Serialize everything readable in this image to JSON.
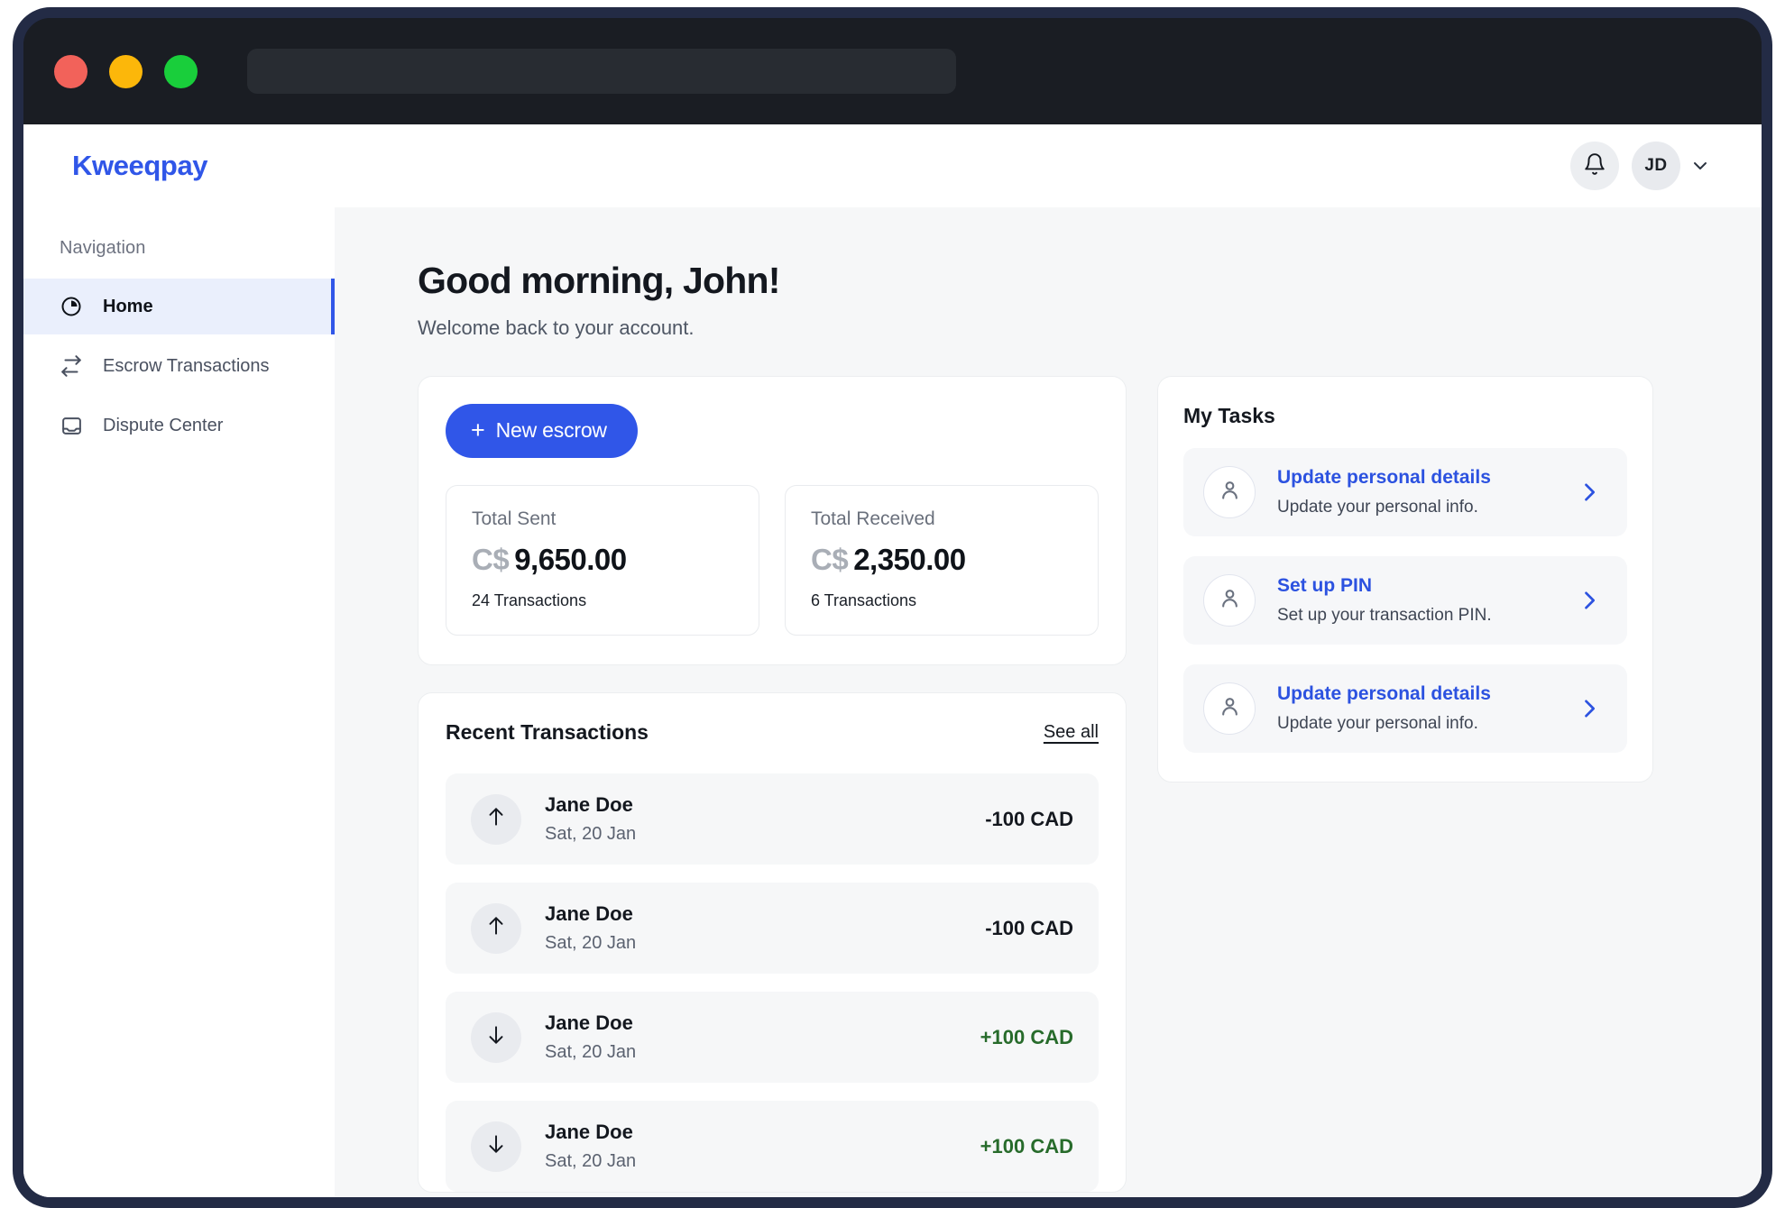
{
  "window": {
    "traffic_lights": [
      {
        "name": "close",
        "color": "#f2625a"
      },
      {
        "name": "minimize",
        "color": "#fcb70a"
      },
      {
        "name": "maximize",
        "color": "#19ce3b"
      }
    ],
    "url_value": "",
    "url_placeholder": ""
  },
  "app_bar": {
    "brand": "Kweeqpay",
    "notification_icon": "bell-icon",
    "avatar_initials": "JD",
    "chevron_icon": "chevron-down-icon"
  },
  "sidebar": {
    "heading": "Navigation",
    "items": [
      {
        "label": "Home",
        "icon": "clock-pie-icon",
        "active": true
      },
      {
        "label": "Escrow Transactions",
        "icon": "exchange-arrows-icon",
        "active": false
      },
      {
        "label": "Dispute Center",
        "icon": "inbox-icon",
        "active": false
      }
    ]
  },
  "main": {
    "greeting": "Good morning, John!",
    "greeting_sub": "Welcome back to your account.",
    "new_escrow_label": "New escrow",
    "plus_icon": "plus-icon",
    "stats": [
      {
        "label": "Total Sent",
        "currency": "C$",
        "amount": "9,650.00",
        "count": "24 Transactions"
      },
      {
        "label": "Total Received",
        "currency": "C$",
        "amount": "2,350.00",
        "count": "6 Transactions"
      }
    ],
    "transactions": {
      "title": "Recent Transactions",
      "see_all": "See all",
      "rows": [
        {
          "name": "Jane Doe",
          "date": "Sat, 20 Jan",
          "amount": "-100 CAD",
          "direction": "out",
          "icon": "arrow-up-icon",
          "credit": false
        },
        {
          "name": "Jane Doe",
          "date": "Sat, 20 Jan",
          "amount": "-100 CAD",
          "direction": "out",
          "icon": "arrow-up-icon",
          "credit": false
        },
        {
          "name": "Jane Doe",
          "date": "Sat, 20 Jan",
          "amount": "+100 CAD",
          "direction": "in",
          "icon": "arrow-down-icon",
          "credit": true
        },
        {
          "name": "Jane Doe",
          "date": "Sat, 20 Jan",
          "amount": "+100 CAD",
          "direction": "in",
          "icon": "arrow-down-icon",
          "credit": true
        }
      ]
    }
  },
  "tasks": {
    "title": "My Tasks",
    "items": [
      {
        "title": "Update personal details",
        "desc": "Update your personal info.",
        "icon": "user-icon",
        "chevron": "chevron-right-icon"
      },
      {
        "title": "Set up PIN",
        "desc": "Set up your transaction PIN.",
        "icon": "user-icon",
        "chevron": "chevron-right-icon"
      },
      {
        "title": "Update personal details",
        "desc": "Update your personal info.",
        "icon": "user-icon",
        "chevron": "chevron-right-icon"
      }
    ]
  },
  "colors": {
    "brand": "#3056e8",
    "credit": "#276b2b",
    "sidebar_active_bg": "#eaeffc",
    "page_bg": "#f6f7f8"
  }
}
